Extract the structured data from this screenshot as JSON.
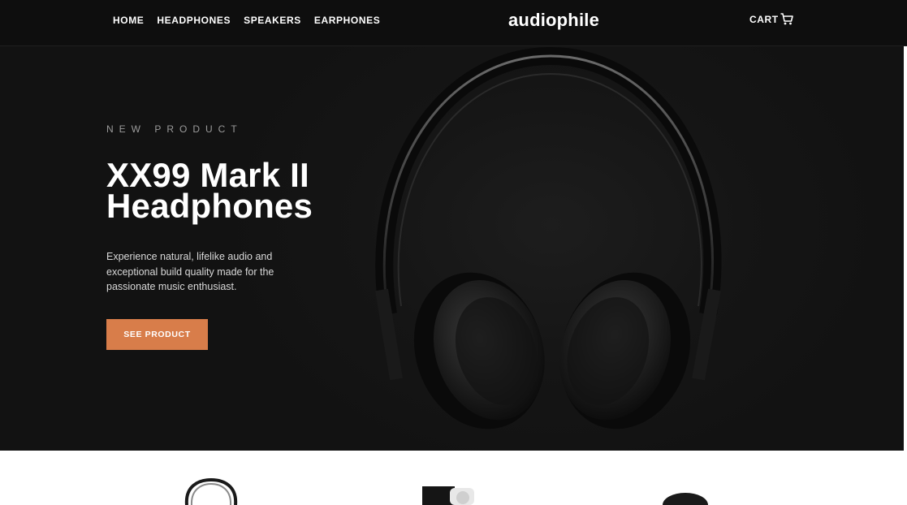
{
  "header": {
    "nav": [
      "HOME",
      "HEADPHONES",
      "SPEAKERS",
      "EARPHONES"
    ],
    "logo": "audiophile",
    "cart_label": "CART",
    "cart_icon": "shopping-cart-icon"
  },
  "hero": {
    "overline": "NEW PRODUCT",
    "title_line1": "XX99 Mark II",
    "title_line2": "Headphones",
    "description": "Experience natural, lifelike audio and exceptional build quality made for the passionate music enthusiast.",
    "cta_label": "SEE PRODUCT",
    "image": "headphones-hero-image"
  },
  "categories": {
    "thumbnails": [
      "headphones-thumbnail",
      "speaker-thumbnail",
      "earphones-thumbnail"
    ]
  },
  "colors": {
    "accent": "#D87D4A",
    "header_bg": "#0E0E0E",
    "hero_bg": "#141414"
  }
}
